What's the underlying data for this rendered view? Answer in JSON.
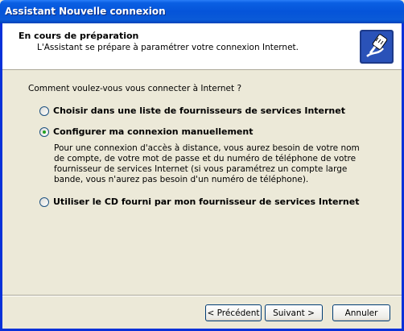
{
  "window": {
    "title": "Assistant Nouvelle connexion"
  },
  "header": {
    "title": "En cours de préparation",
    "subtitle": "L'Assistant se prépare à paramétrer votre connexion Internet.",
    "icon": "connection-wizard-icon"
  },
  "main": {
    "prompt": "Comment voulez-vous vous connecter à Internet ?",
    "options": [
      {
        "label": "Choisir dans une liste de fournisseurs de services Internet",
        "checked": false
      },
      {
        "label": "Configurer ma connexion manuellement",
        "checked": true
      },
      {
        "label": "Utiliser le CD fourni par mon fournisseur de services Internet",
        "checked": false
      }
    ],
    "description": "Pour une connexion d'accès à distance, vous aurez besoin de votre nom de compte, de votre mot de passe et du numéro de téléphone de votre fournisseur de services Internet (si vous paramétrez un compte large bande, vous n'aurez pas besoin d'un numéro de téléphone)."
  },
  "buttons": {
    "back": "< Précédent",
    "next": "Suivant >",
    "cancel": "Annuler"
  }
}
